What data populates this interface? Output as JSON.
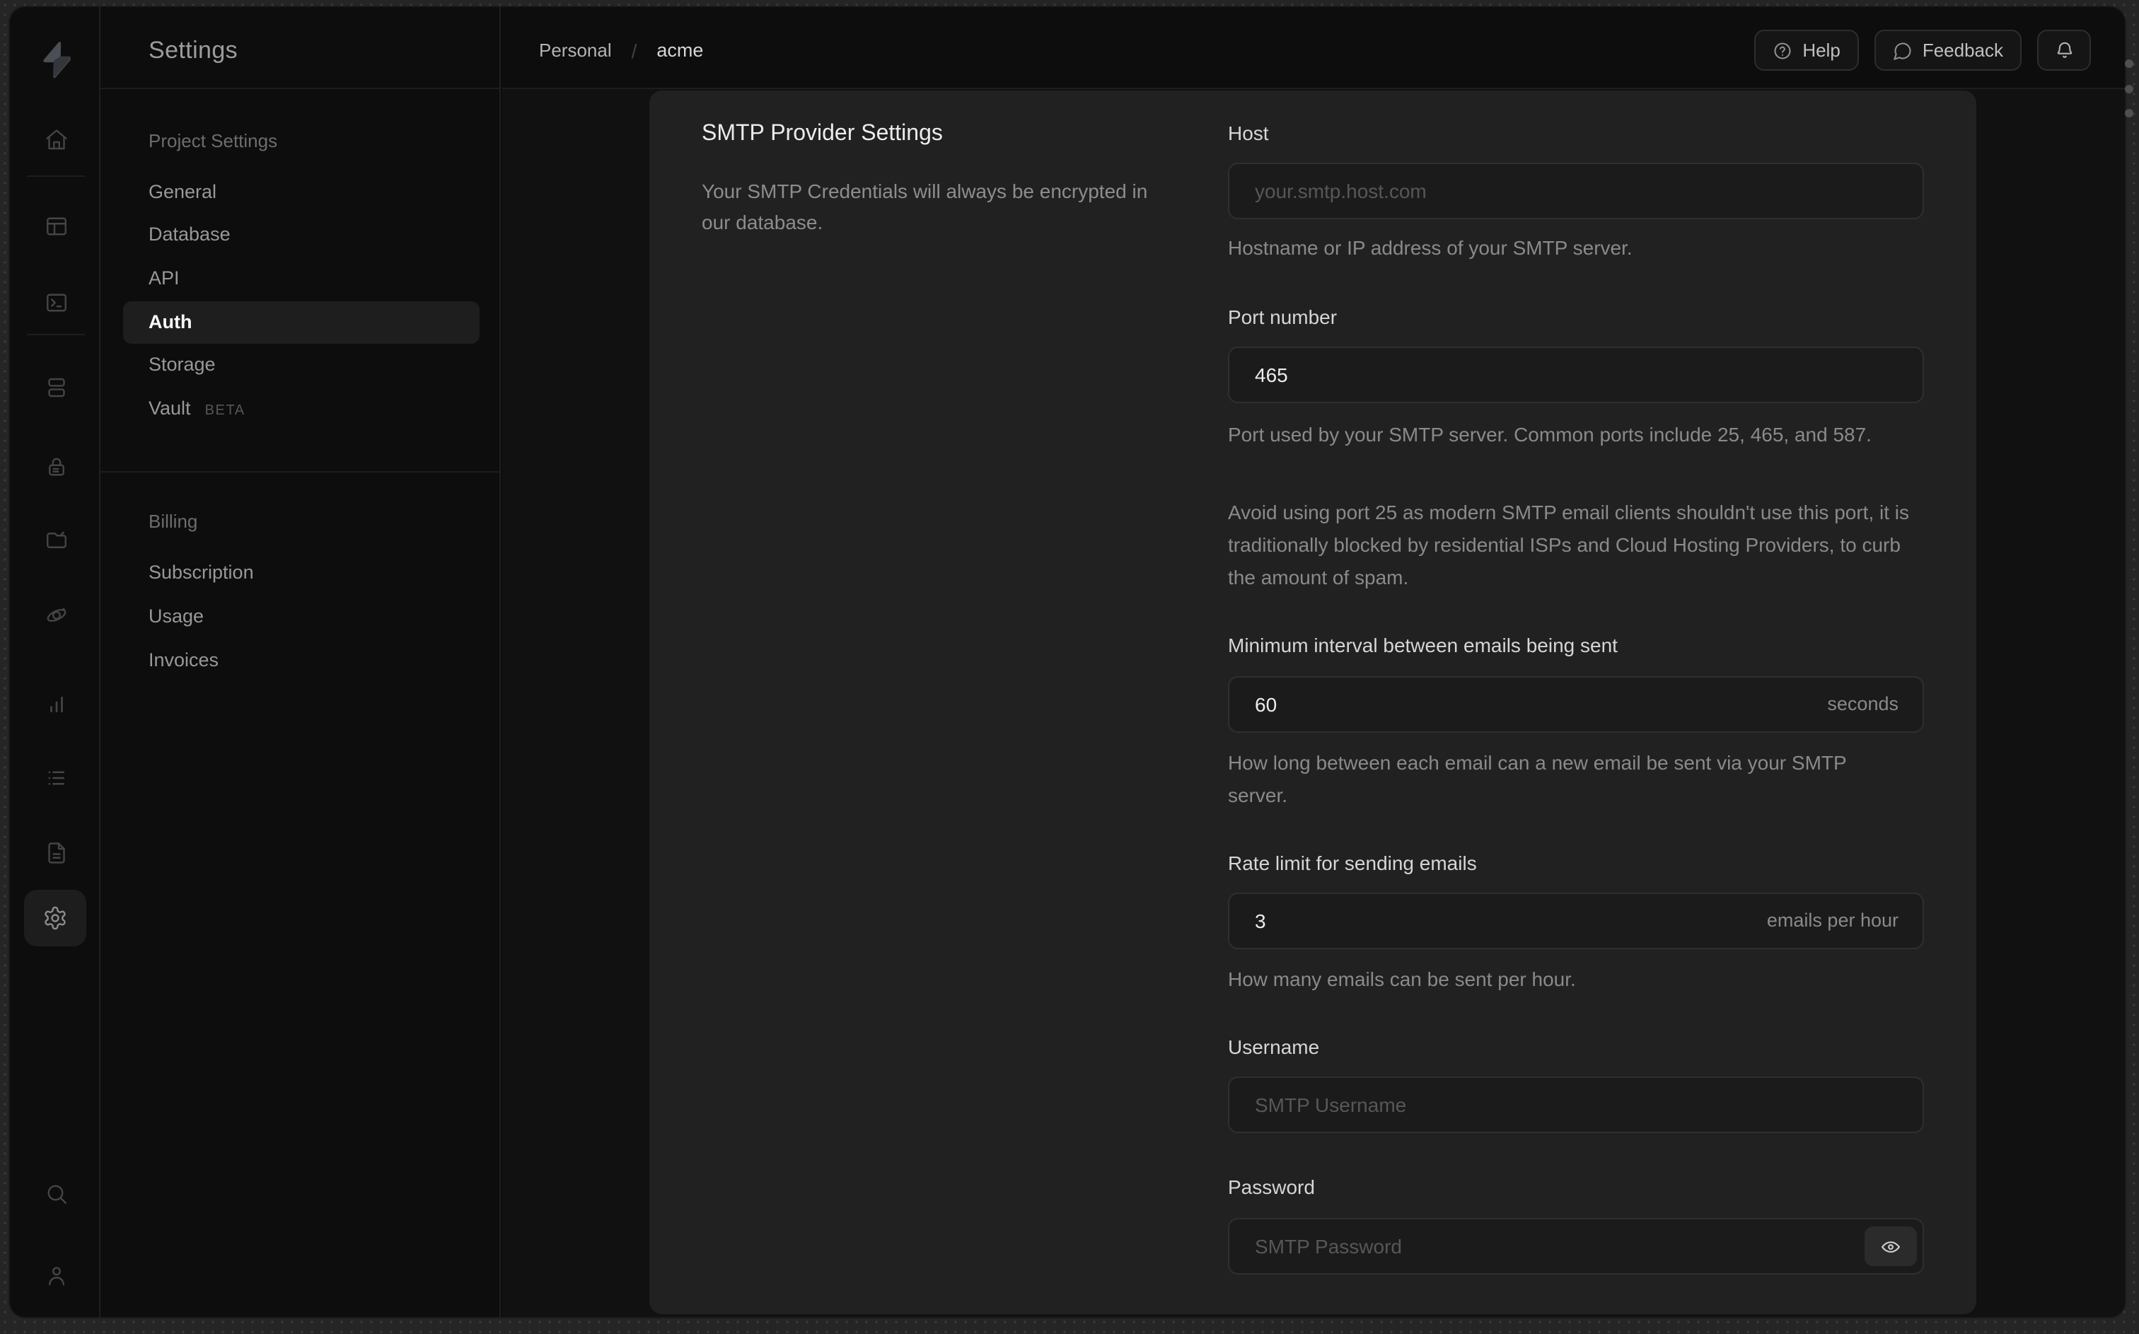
{
  "header": {
    "breadcrumb": {
      "org": "Personal",
      "separator": "/",
      "project": "acme"
    },
    "actions": {
      "help": "Help",
      "feedback": "Feedback",
      "notifications_icon": "bell-icon"
    }
  },
  "rail": {
    "icons": [
      "home-icon",
      "table-editor-icon",
      "sql-editor-icon",
      "database-icon",
      "auth-icon",
      "storage-icon",
      "edge-functions-icon",
      "reports-icon",
      "logs-icon",
      "api-docs-icon",
      "settings-icon",
      "search-icon",
      "user-icon"
    ],
    "active": "settings-icon"
  },
  "sidebar": {
    "title": "Settings",
    "sections": [
      {
        "heading": "Project Settings",
        "items": [
          {
            "label": "General"
          },
          {
            "label": "Database"
          },
          {
            "label": "API"
          },
          {
            "label": "Auth",
            "active": true
          },
          {
            "label": "Storage"
          },
          {
            "label": "Vault",
            "badge": "BETA"
          }
        ]
      },
      {
        "heading": "Billing",
        "items": [
          {
            "label": "Subscription"
          },
          {
            "label": "Usage"
          },
          {
            "label": "Invoices"
          }
        ]
      }
    ]
  },
  "content": {
    "section": {
      "title": "SMTP Provider Settings",
      "description": "Your SMTP Credentials will always be encrypted in our database."
    },
    "fields": {
      "host": {
        "label": "Host",
        "placeholder": "your.smtp.host.com",
        "helper": "Hostname or IP address of your SMTP server."
      },
      "port": {
        "label": "Port number",
        "value": "465",
        "helper": "Port used by your SMTP server. Common ports include 25, 465, and 587.",
        "note": "Avoid using port 25 as modern SMTP email clients shouldn't use this port, it is traditionally blocked by residential ISPs and Cloud Hosting Providers, to curb the amount of spam."
      },
      "interval": {
        "label": "Minimum interval between emails being sent",
        "value": "60",
        "unit": "seconds",
        "helper": "How long between each email can a new email be sent via your SMTP server."
      },
      "rate": {
        "label": "Rate limit for sending emails",
        "value": "3",
        "unit": "emails per hour",
        "helper": "How many emails can be sent per hour."
      },
      "username": {
        "label": "Username",
        "placeholder": "SMTP Username"
      },
      "password": {
        "label": "Password",
        "placeholder": "SMTP Password"
      }
    }
  },
  "colors": {
    "window": "#0d0d0d",
    "content_bg": "#111111",
    "panel": "#212121",
    "border": "#2f2f2f",
    "text_primary": "#ececec",
    "text_muted": "#8a8a8a"
  }
}
